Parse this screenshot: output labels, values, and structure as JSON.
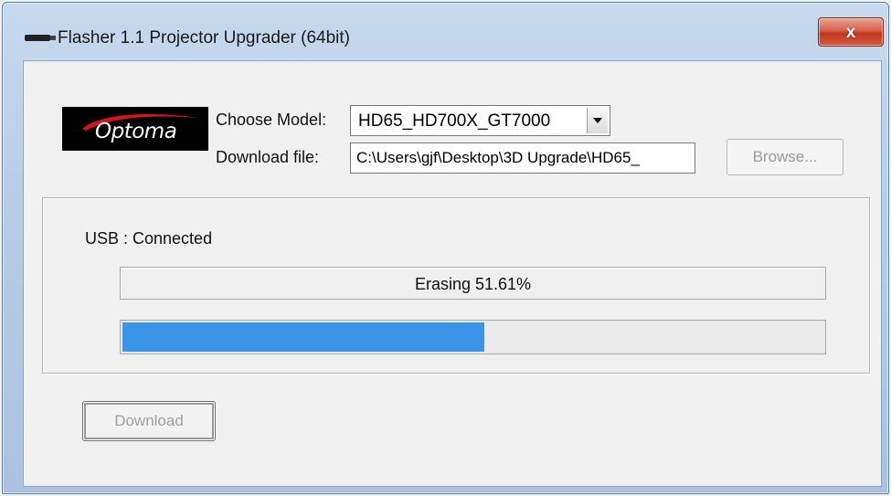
{
  "window": {
    "title": "Flasher 1.1 Projector Upgrader (64bit)",
    "close_glyph": "x"
  },
  "logo": {
    "brand_text": "Optoma",
    "swoosh_color": "#d7141a"
  },
  "form": {
    "model_label": "Choose Model:",
    "model_value": "HD65_HD700X_GT7000",
    "file_label": "Download file:",
    "file_value": "C:\\Users\\gjf\\Desktop\\3D Upgrade\\HD65_",
    "browse_label": "Browse..."
  },
  "status": {
    "usb_text": "USB : Connected",
    "progress_text": "Erasing  51.61%",
    "progress_fraction": 0.5161,
    "progress_color": "#3a94e8"
  },
  "actions": {
    "download_label": "Download"
  },
  "icons": {
    "app": "projector-app-icon",
    "close": "close-icon",
    "dropdown": "chevron-down-icon"
  }
}
